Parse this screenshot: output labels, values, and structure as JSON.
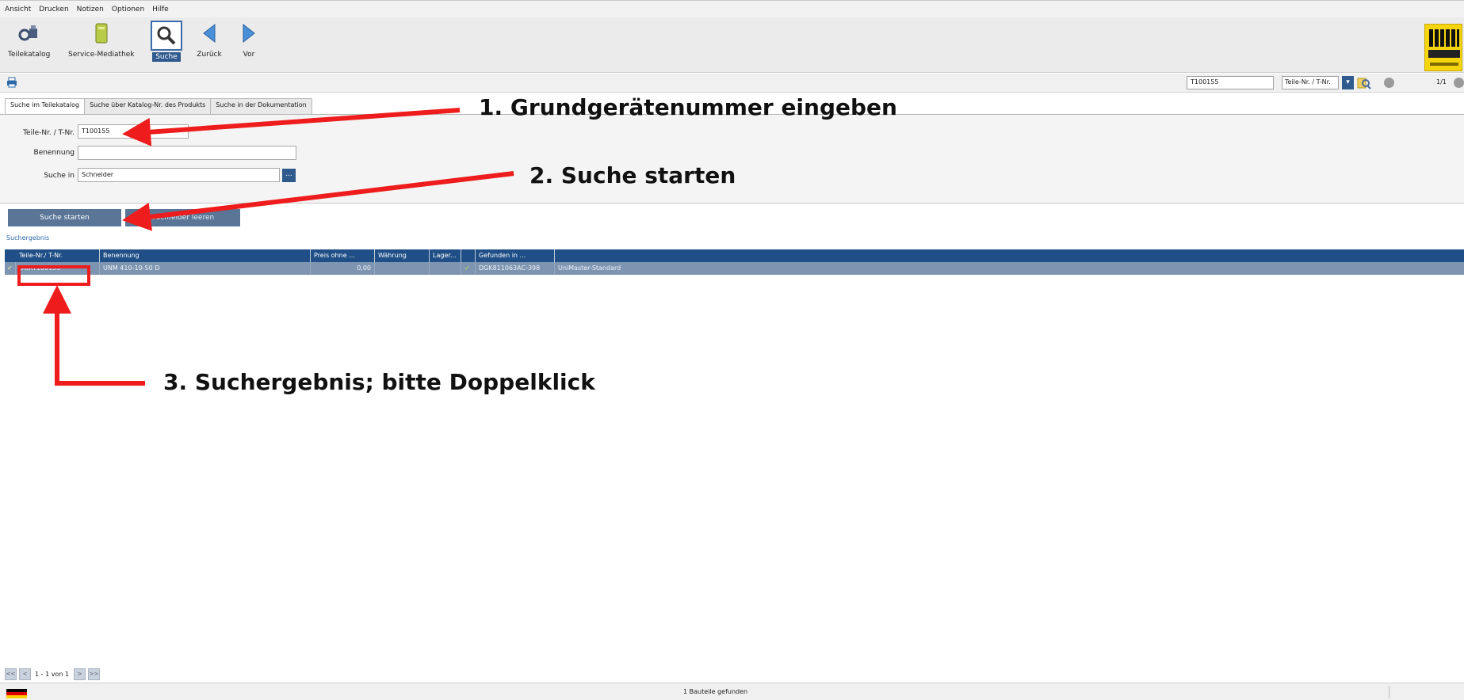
{
  "menu": [
    "Ansicht",
    "Drucken",
    "Notizen",
    "Optionen",
    "Hilfe"
  ],
  "toolbar": {
    "teilekatalog": "Teilekatalog",
    "mediathek": "Service-Mediathek",
    "suche": "Suche",
    "zurueck": "Zurück",
    "vor": "Vor"
  },
  "quicksearch": {
    "value": "T100155",
    "mode": "Teile-Nr. / T-Nr.",
    "page": "1/1"
  },
  "tabs": [
    "Suche im Teilekatalog",
    "Suche über Katalog-Nr. des Produkts",
    "Suche in der Dokumentation"
  ],
  "form": {
    "teilenr_label": "Teile-Nr. / T-Nr.",
    "teilenr_value": "T100155",
    "benennung_label": "Benennung",
    "benennung_value": "",
    "suchein_label": "Suche in",
    "suchein_value": "Schneider",
    "browse": "..."
  },
  "buttons": {
    "start": "Suche starten",
    "clear": "Suchfelder leeren"
  },
  "result_label": "Suchergebnis",
  "table": {
    "headers": [
      "Teile-Nr./ T-Nr.",
      "Benennung",
      "Preis ohne ...",
      "Währung",
      "Lager...",
      "",
      "Gefunden in ..."
    ],
    "rows": [
      {
        "checkmark": "✔",
        "teilenr": "DGKT100155",
        "benennung": "UNM 410-10-50 D",
        "preis": "0,00",
        "waehrung": "",
        "lager": "",
        "flag": "✔",
        "gefunden": "DGK811063AC-398",
        "katalog": "UniMaster-Standard"
      }
    ]
  },
  "annotations": {
    "step1": "1. Grundgerätenummer eingeben",
    "step2": "2. Suche starten",
    "step3": "3. Suchergebnis; bitte Doppelklick"
  },
  "pager": {
    "first": "<<",
    "prev": "<",
    "text": "1 - 1 von 1",
    "next": ">",
    "last": ">>"
  },
  "status": "1 Bauteile gefunden",
  "colors": {
    "accent": "#1f4f86",
    "annotation": "#ee1c1c",
    "selected_row": "#7e95b1"
  }
}
